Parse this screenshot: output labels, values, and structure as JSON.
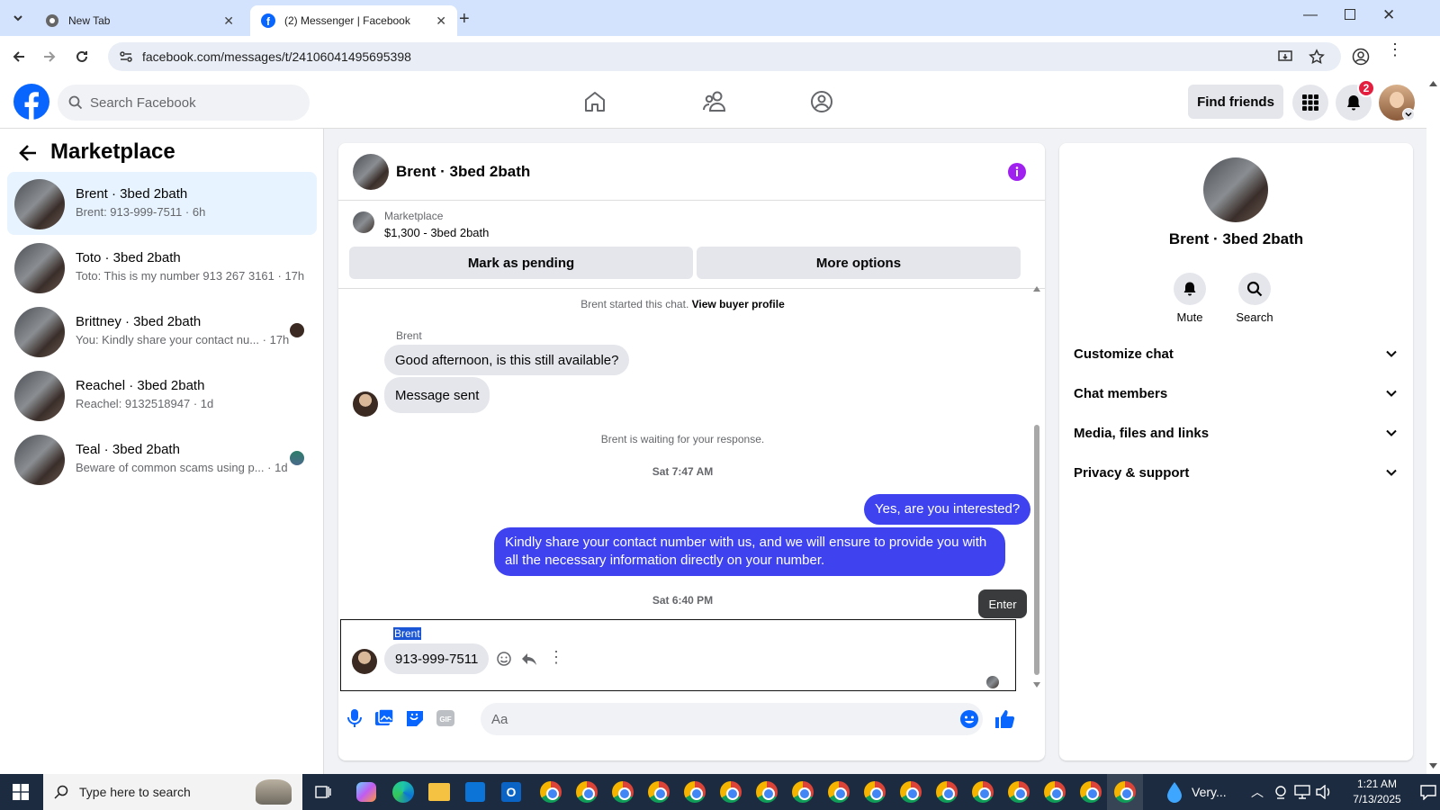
{
  "browser": {
    "tabs": [
      {
        "title": "New Tab"
      },
      {
        "title": "(2) Messenger | Facebook"
      }
    ],
    "url": "facebook.com/messages/t/24106041495695398"
  },
  "fb_header": {
    "search_placeholder": "Search Facebook",
    "find_friends": "Find friends",
    "notification_count": "2"
  },
  "sidebar": {
    "title": "Marketplace",
    "conversations": [
      {
        "name": "Brent · 3bed 2bath",
        "preview": "Brent: 913-999-7511 · 6h"
      },
      {
        "name": "Toto · 3bed 2bath",
        "preview": "Toto: This is my number 913 267 3161 · 17h"
      },
      {
        "name": "Brittney · 3bed 2bath",
        "preview": "You: Kindly share your contact nu... · 17h"
      },
      {
        "name": "Reachel · 3bed 2bath",
        "preview": "Reachel: 9132518947 · 1d"
      },
      {
        "name": "Teal · 3bed 2bath",
        "preview": "Beware of common scams using p... · 1d"
      }
    ]
  },
  "chat": {
    "title": "Brent · 3bed 2bath",
    "context_label": "Marketplace",
    "context_listing": "$1,300 - 3bed 2bath",
    "mark_pending": "Mark as pending",
    "more_options": "More options",
    "started_text": "Brent started this chat.",
    "view_profile": "View buyer profile",
    "sender_name": "Brent",
    "msg1": "Good afternoon, is this still available?",
    "msg2": "Message sent",
    "waiting_text": "Brent is waiting for your response.",
    "time1": "Sat 7:47 AM",
    "out1": "Yes, are you interested?",
    "out2": "Kindly share your contact number with us, and we will ensure to provide you with all the necessary information directly on your number.",
    "time2": "Sat 6:40 PM",
    "tooltip": "Enter",
    "sender_name2": "Brent",
    "msg3": "913-999-7511",
    "input_placeholder": "Aa"
  },
  "info": {
    "name": "Brent · 3bed 2bath",
    "mute": "Mute",
    "search": "Search",
    "sections": [
      "Customize chat",
      "Chat members",
      "Media, files and links",
      "Privacy & support"
    ]
  },
  "taskbar": {
    "search_placeholder": "Type here to search",
    "weather": "Very...",
    "time": "1:21 AM",
    "date": "7/13/2025"
  },
  "colors": {
    "accent": "#0866ff",
    "outgoing_bubble": "#3e42ef",
    "info_icon": "#a020f0",
    "notification": "#e41e3f"
  }
}
